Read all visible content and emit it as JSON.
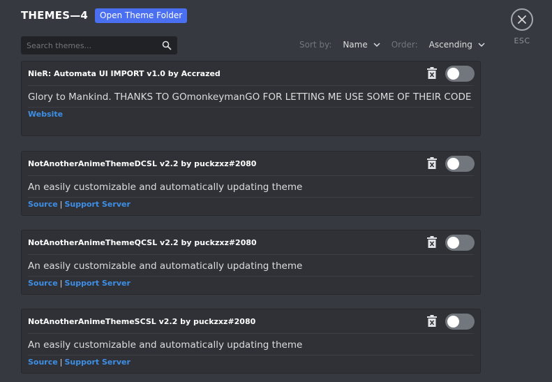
{
  "header": {
    "title": "THEMES—4",
    "open_folder_label": "Open Theme Folder"
  },
  "close": {
    "label": "ESC"
  },
  "search": {
    "placeholder": "Search themes..."
  },
  "sort": {
    "sort_label": "Sort by:",
    "sort_value": "Name",
    "order_label": "Order:",
    "order_value": "Ascending"
  },
  "themes": [
    {
      "title": "NieR: Automata UI IMPORT v1.0 by Accrazed",
      "description": "Glory to Mankind. THANKS TO GOmonkeymanGO FOR LETTING ME USE SOME OF THEIR CODE",
      "link1": "Website"
    },
    {
      "title": "NotAnotherAnimeThemeDCSL v2.2 by puckzxz#2080",
      "description": "An easily customizable and automatically updating theme",
      "link1": "Source",
      "separator": "|",
      "link2": "Support Server"
    },
    {
      "title": "NotAnotherAnimeThemeQCSL v2.2 by puckzxz#2080",
      "description": "An easily customizable and automatically updating theme",
      "link1": "Source",
      "separator": "|",
      "link2": "Support Server"
    },
    {
      "title": "NotAnotherAnimeThemeSCSL v2.2 by puckzxz#2080",
      "description": "An easily customizable and automatically updating theme",
      "link1": "Source",
      "separator": "|",
      "link2": "Support Server"
    }
  ],
  "icons": {
    "close": "close-icon",
    "search": "search-icon",
    "chevron": "chevron-down-icon",
    "trash": "trash-icon"
  },
  "colors": {
    "background": "#36393f",
    "card": "#2f3136",
    "accent": "#4a6ff0",
    "link": "#3e8fe6",
    "toggle_off": "#72767d"
  }
}
